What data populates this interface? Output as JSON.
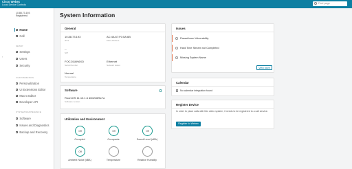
{
  "topbar": {
    "brand_line1": "Cisco Webex",
    "brand_line2": "Local Device Controls",
    "search_placeholder": "Find page"
  },
  "sidebar": {
    "device_ip": "10.88.73.193",
    "device_name": "Registered",
    "items": {
      "home": "Home",
      "call": "Call",
      "settings": "Settings",
      "users": "Users",
      "security": "Security",
      "personalization": "Personalization",
      "ui_ext": "UI Extensions Editor",
      "macro": "Macro Editor",
      "dev_api": "Developer API",
      "software": "Software",
      "issues": "Issues and Diagnostics",
      "backup": "Backup and Recovery"
    },
    "sections": {
      "setup": "Setup",
      "customization": "Customization",
      "maintenance": "System Maintenance"
    }
  },
  "main": {
    "title": "System Information"
  },
  "general": {
    "title": "General",
    "ip_value": "10.88.73.193",
    "ip_label": "IPv4",
    "mac_value": "AC:4A:67:F0:5A:6B",
    "mac_label": "MAC Address",
    "sip_value": "--",
    "sip_label": "SIP",
    "serial_value": "FOC2416N6XD",
    "serial_label": "Serial Number",
    "net_value": "Ethernet",
    "net_label": "Network status",
    "temp_value": "Normal",
    "temp_label": "Temperature"
  },
  "software": {
    "title": "Software",
    "version": "RoomOS 11.10.1.6 d60246f5c7a",
    "label": "Software version"
  },
  "utilization": {
    "title": "Utilization and Environment",
    "gauges": [
      {
        "value": "Off",
        "label": "Occupied"
      },
      {
        "value": "Off",
        "label": "Occupants"
      },
      {
        "value": "Off",
        "label": "Sound Level (dBA)"
      },
      {
        "value": "Off",
        "label": "Ambient Noise (dBA)"
      },
      {
        "value": "",
        "label": "Temperature"
      },
      {
        "value": "",
        "label": "Relative Humidity"
      }
    ]
  },
  "issues": {
    "title": "Issues",
    "items": [
      "Passethrow Vulnerability",
      "Hard Time Stream not Completed",
      "Missing System Name"
    ],
    "view_more": "View More"
  },
  "calendar": {
    "title": "Calendar",
    "message": "No calendar integration found"
  },
  "register": {
    "title": "Register Device",
    "text": "In order to place calls with this video system, it needs to be registered to a call service.",
    "button": "Register to Webex"
  },
  "colors": {
    "brand": "#0d7fa2",
    "gauge": "#17998e",
    "issue_accent": "#e4754f"
  }
}
